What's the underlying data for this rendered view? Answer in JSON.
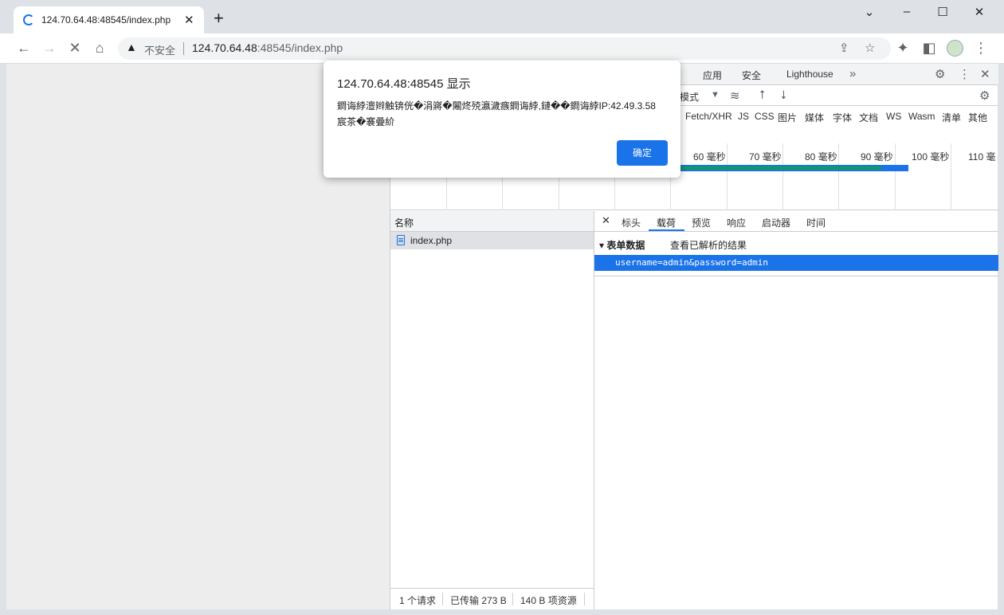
{
  "browser": {
    "tab_title": "124.70.64.48:48545/index.php",
    "security_label": "不安全",
    "url_host": "124.70.64.48",
    "url_rest": ":48545/index.php"
  },
  "dialog": {
    "title": "124.70.64.48:48545 显示",
    "message": "鐧诲綍澶辫触锛侊�涓嶈�闂炵殑瀛濊瘯鐧诲綍,鏈��鐧诲綍IP:42.49.3.58宸茶�褰曡紒",
    "ok_label": "确定"
  },
  "devtools": {
    "tabs": [
      "应用",
      "安全",
      "Lighthouse"
    ],
    "mode_fragment": "模式",
    "filters": [
      "Fetch/XHR",
      "JS",
      "CSS",
      "图片",
      "媒体",
      "字体",
      "文档",
      "WS",
      "Wasm",
      "清单",
      "其他"
    ],
    "timeline_labels": [
      "60 毫秒",
      "70 毫秒",
      "80 毫秒",
      "90 毫秒",
      "100 毫秒",
      "110 毫"
    ],
    "name_header": "名称",
    "requests": [
      "index.php"
    ],
    "detail_tabs": [
      "标头",
      "载荷",
      "预览",
      "响应",
      "启动器",
      "时间"
    ],
    "active_detail_tab": "载荷",
    "form_data_label": "表单数据",
    "view_parsed_label": "查看已解析的结果",
    "payload": "username=admin&password=admin",
    "status": [
      "1 个请求",
      "已传输 273 B",
      "140 B 项资源"
    ]
  }
}
